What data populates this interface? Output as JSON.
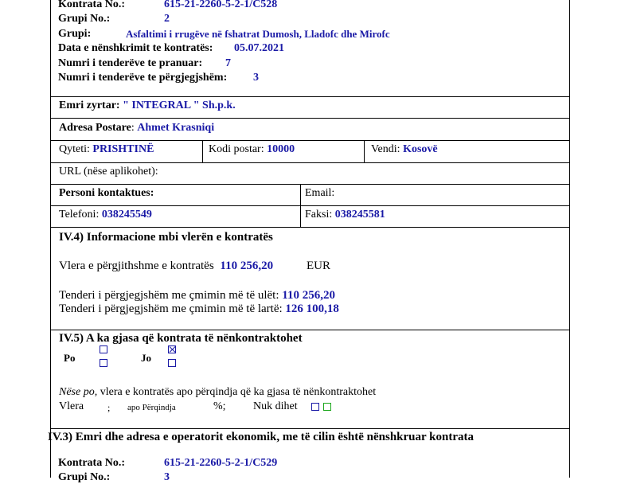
{
  "top_block": {
    "contract_label": "Kontrata No.:",
    "contract_value": "615-21-2260-5-2-1/C528",
    "group_no_label": "Grupi No.:",
    "group_no_value": "2",
    "group_label": "Grupi:",
    "group_value": "Asfaltimi i rrugëve në fshatrat Dumosh, Lladofc dhe Mirofc",
    "sign_date_label": "Data e nënshkrimit te kontratës:",
    "sign_date_value": "05.07.2021",
    "received_label": "Numri i tenderëve te pranuar:",
    "received_value": "7",
    "responsive_label": "Numri i tenderëve te përgjegjshëm:",
    "responsive_value": "3"
  },
  "operator": {
    "official_name_label": "Emri zyrtar",
    "official_name_value": "\" INTEGRAL \" Sh.p.k.",
    "postal_address_label": "Adresa Postare",
    "postal_address_value": "Ahmet Krasniqi",
    "city_label": "Qyteti:",
    "city_value": "PRISHTINË",
    "postal_code_label": "Kodi postar:",
    "postal_code_value": "10000",
    "country_label": "Vendi:",
    "country_value": "Kosovë",
    "url_label": "URL (nëse aplikohet):",
    "contact_label": "Personi kontaktues:",
    "email_label": "Email:",
    "phone_label": "Telefoni:",
    "phone_value": "038245549",
    "fax_label": "Faksi:",
    "fax_value": "038245581"
  },
  "section_iv4": {
    "title": "IV.4) Informacione mbi vlerën e kontratës",
    "total_label": "Vlera e përgjithshme e kontratës",
    "total_value": "110 256,20",
    "currency": "EUR",
    "lowest_label": "Tenderi i përgjegjshëm me çmimin më të ulët:",
    "lowest_value": "110 256,20",
    "highest_label": "Tenderi i përgjegjshëm me çmimin më të lartë:",
    "highest_value": "126 100,18"
  },
  "section_iv5": {
    "title": "IV.5) A ka gjasa që kontrata të nënkontraktohet",
    "yes_label": "Po",
    "no_label": "Jo",
    "yes_checked": false,
    "no_checked": true,
    "note_italic": "Nëse po,",
    "note_text": "vlera e kontratës apo përqindja që ka gjasa të nënkontraktohet",
    "value_label": "Vlera",
    "value_sep": ";",
    "percent_label": "apo Përqindja",
    "percent_suffix": "%;",
    "unknown_label": "Nuk dihet"
  },
  "section_iv3": {
    "title": "IV.3) Emri dhe adresa e operatorit ekonomik, me të cilin është nënshkruar kontrata",
    "contract_label": "Kontrata No.:",
    "contract_value": "615-21-2260-5-2-1/C529",
    "group_no_label": "Grupi No.:",
    "group_no_value": "3"
  }
}
